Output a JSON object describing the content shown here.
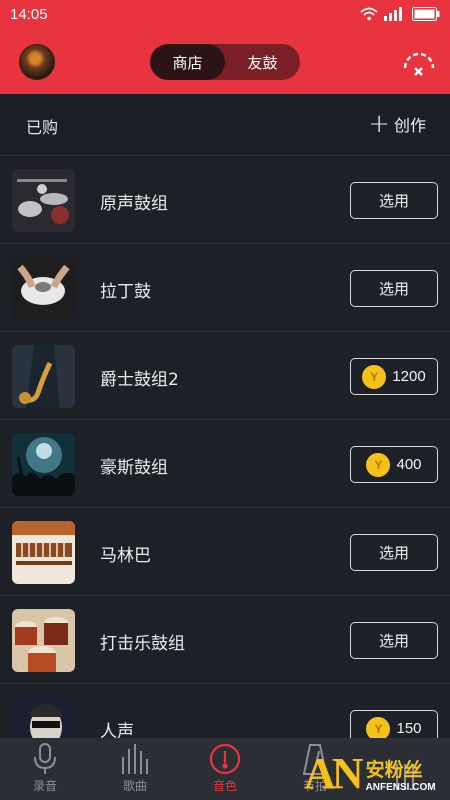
{
  "status_bar": {
    "time": "14:05"
  },
  "header": {
    "tabs": [
      {
        "label": "商店",
        "active": true
      },
      {
        "label": "友鼓",
        "active": false
      }
    ]
  },
  "purchased": {
    "label": "已购",
    "create_label": "创作"
  },
  "items": [
    {
      "name": "原声鼓组",
      "action": "选用",
      "thumb": "drum-kit"
    },
    {
      "name": "拉丁鼓",
      "action": "选用",
      "thumb": "latin-drum"
    },
    {
      "name": "爵士鼓组2",
      "coin_symbol": "Y",
      "price": "1200",
      "thumb": "saxophone"
    },
    {
      "name": "豪斯鼓组",
      "coin_symbol": "Y",
      "price": "400",
      "thumb": "concert"
    },
    {
      "name": "马林巴",
      "action": "选用",
      "thumb": "marimba"
    },
    {
      "name": "打击乐鼓组",
      "action": "选用",
      "thumb": "percussion"
    },
    {
      "name": "人声",
      "coin_symbol": "Y",
      "price": "150",
      "thumb": "vocal"
    }
  ],
  "bottom_nav": [
    {
      "label": "录音",
      "icon": "microphone-icon",
      "active": false
    },
    {
      "label": "歌曲",
      "icon": "equalizer-icon",
      "active": false
    },
    {
      "label": "音色",
      "icon": "drum-icon",
      "active": true
    },
    {
      "label": "节拍",
      "icon": "metronome-icon",
      "active": false
    },
    {
      "label": "",
      "icon": "grid-icon",
      "active": false
    }
  ],
  "watermark": {
    "logo": "AN",
    "cn": "安粉丝",
    "en": "ANFENSI.COM"
  },
  "colors": {
    "accent": "#e8343f",
    "background": "#1d2026",
    "coin": "#f6c21a"
  }
}
